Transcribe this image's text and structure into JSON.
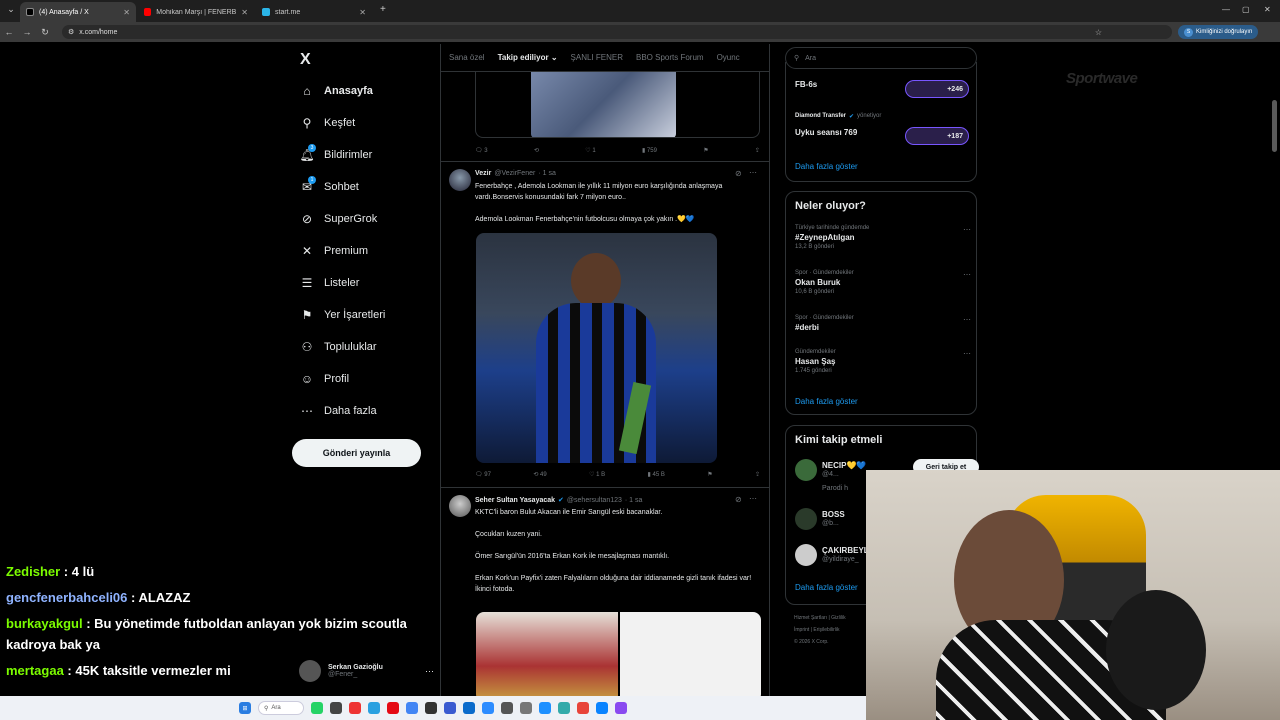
{
  "browser": {
    "tabs": [
      {
        "label": "(4) Anasayfa / X",
        "active": true,
        "color": "#000000"
      },
      {
        "label": "Mohikan Marşı | FENERBAHÇE",
        "active": false,
        "color": "#ff0000"
      },
      {
        "label": "start.me",
        "active": false,
        "color": "#2bb5e8"
      }
    ],
    "new_tab": "+",
    "url": "x.com/home",
    "verify_label": "Kimliğinizi doğrulayın",
    "verify_initial": "S"
  },
  "nav": {
    "logo": "X",
    "items": [
      {
        "label": "Anasayfa",
        "icon": "home-icon",
        "glyph": "⌂",
        "bold": true
      },
      {
        "label": "Keşfet",
        "icon": "search-icon",
        "glyph": "⚲"
      },
      {
        "label": "Bildirimler",
        "icon": "bell-icon",
        "glyph": "🔔︎",
        "badge": "3"
      },
      {
        "label": "Sohbet",
        "icon": "mail-icon",
        "glyph": "✉",
        "badge": "1"
      },
      {
        "label": "SuperGrok",
        "icon": "grok-icon",
        "glyph": "⊘"
      },
      {
        "label": "Premium",
        "icon": "x-premium-icon",
        "glyph": "✕"
      },
      {
        "label": "Listeler",
        "icon": "list-icon",
        "glyph": "☰"
      },
      {
        "label": "Yer İşaretleri",
        "icon": "bookmark-icon",
        "glyph": "⚑"
      },
      {
        "label": "Topluluklar",
        "icon": "communities-icon",
        "glyph": "⚇"
      },
      {
        "label": "Profil",
        "icon": "person-icon",
        "glyph": "☺"
      },
      {
        "label": "Daha fazla",
        "icon": "more-icon",
        "glyph": "⋯"
      }
    ],
    "post_label": "Gönderi yayınla",
    "account": {
      "name": "Serkan Gazioğlu",
      "handle": "@Fener_"
    }
  },
  "chat": [
    {
      "user": "Zedisher",
      "color": "#7CFC00",
      "text": " : 4 lü"
    },
    {
      "user": "gencfenerbahceli06",
      "color": "#8fb3ff",
      "text": " : ALAZAZ"
    },
    {
      "user": "burkayakgul",
      "color": "#7CFC00",
      "text": " : Bu yönetimde futboldan anlayan yok bizim scoutla kadroya bak ya"
    },
    {
      "user": "mertagaa",
      "color": "#7CFC00",
      "text": " : 45K taksitle vermezler mi"
    }
  ],
  "feed": {
    "tabs": [
      "Sana özel",
      "Takip ediliyor",
      "ŞANLI FENER",
      "BBO Sports Forum",
      "Oyunc"
    ],
    "active_tab": "Takip ediliyor",
    "tweets": [
      {
        "name": "",
        "handle": "",
        "time": "",
        "text": [],
        "actions": {
          "replies": "3",
          "reposts": "",
          "likes": "1",
          "views": "759"
        }
      },
      {
        "name": "Vezir",
        "handle": "@VezirFener",
        "time": "· 1 sa",
        "text": [
          "Fenerbahçe , Ademola Lookman ile yıllık 11 milyon euro karşılığında anlaşmaya vardı.Bonservis konusundaki fark 7 milyon euro..",
          "Ademola Lookman Fenerbahçe'nin futbolcusu olmaya çok yakın .💛💙"
        ],
        "actions": {
          "replies": "97",
          "reposts": "49",
          "likes": "1 B",
          "views": "45 B"
        }
      },
      {
        "name": "Seher Sultan Yasayacak",
        "handle": "@sehersultan123",
        "time": "· 1 sa",
        "text": [
          "KKTC'li baron Bulut Akacan ile Emir Sarıgül eski bacanaklar.",
          "Çocukları kuzen yani.",
          "Ömer Sarıgül'ün 2016'ta Erkan Kork ile mesajlaşması mantıklı.",
          "Erkan Kork'un Payfix'i zaten Falyalıların olduğuna dair iddianamede gizli tanık ifadesi var!\nİkinci fotoda."
        ],
        "actions": {
          "replies": "",
          "reposts": "",
          "likes": "",
          "views": ""
        }
      }
    ]
  },
  "right": {
    "search_placeholder": "Ara",
    "spaces": [
      {
        "host": "",
        "title": "FB-6s",
        "count": "+246"
      },
      {
        "host": "Diamond Transfer",
        "role": "yönetiyor",
        "title": "Uyku seansı 769",
        "count": "+187"
      }
    ],
    "spaces_more": "Daha fazla göster",
    "trends_title": "Neler oluyor?",
    "trends": [
      {
        "context": "Türkiye tarihinde gündemde",
        "topic": "#ZeynepAtılgan",
        "posts": "13,2 B gönderi"
      },
      {
        "context": "Spor · Gündemdekiler",
        "topic": "Okan Buruk",
        "posts": "10,6 B gönderi"
      },
      {
        "context": "Spor · Gündemdekiler",
        "topic": "#derbi",
        "posts": ""
      },
      {
        "context": "Gündemdekiler",
        "topic": "Hasan Şaş",
        "posts": "1.745 gönderi"
      }
    ],
    "trends_more": "Daha fazla göster",
    "who_title": "Kimi takip etmeli",
    "who": [
      {
        "name": "NECIP💛💙",
        "handle": "@4...",
        "follow": "Geri takip et",
        "sub": "Parodi h"
      },
      {
        "name": "BOSS",
        "handle": "@b...",
        "follow": ""
      },
      {
        "name": "ÇAKIRBEYL",
        "handle": "@yildiraye_",
        "follow": ""
      }
    ],
    "who_more": "Daha fazla göster",
    "footer": [
      "Hizmet Şartları | Gizlilik",
      "İmprint | Erişilebilirlik",
      "© 2026 X Corp."
    ]
  },
  "brand_text": "Sportwave",
  "taskbar": {
    "search": "Ara"
  }
}
